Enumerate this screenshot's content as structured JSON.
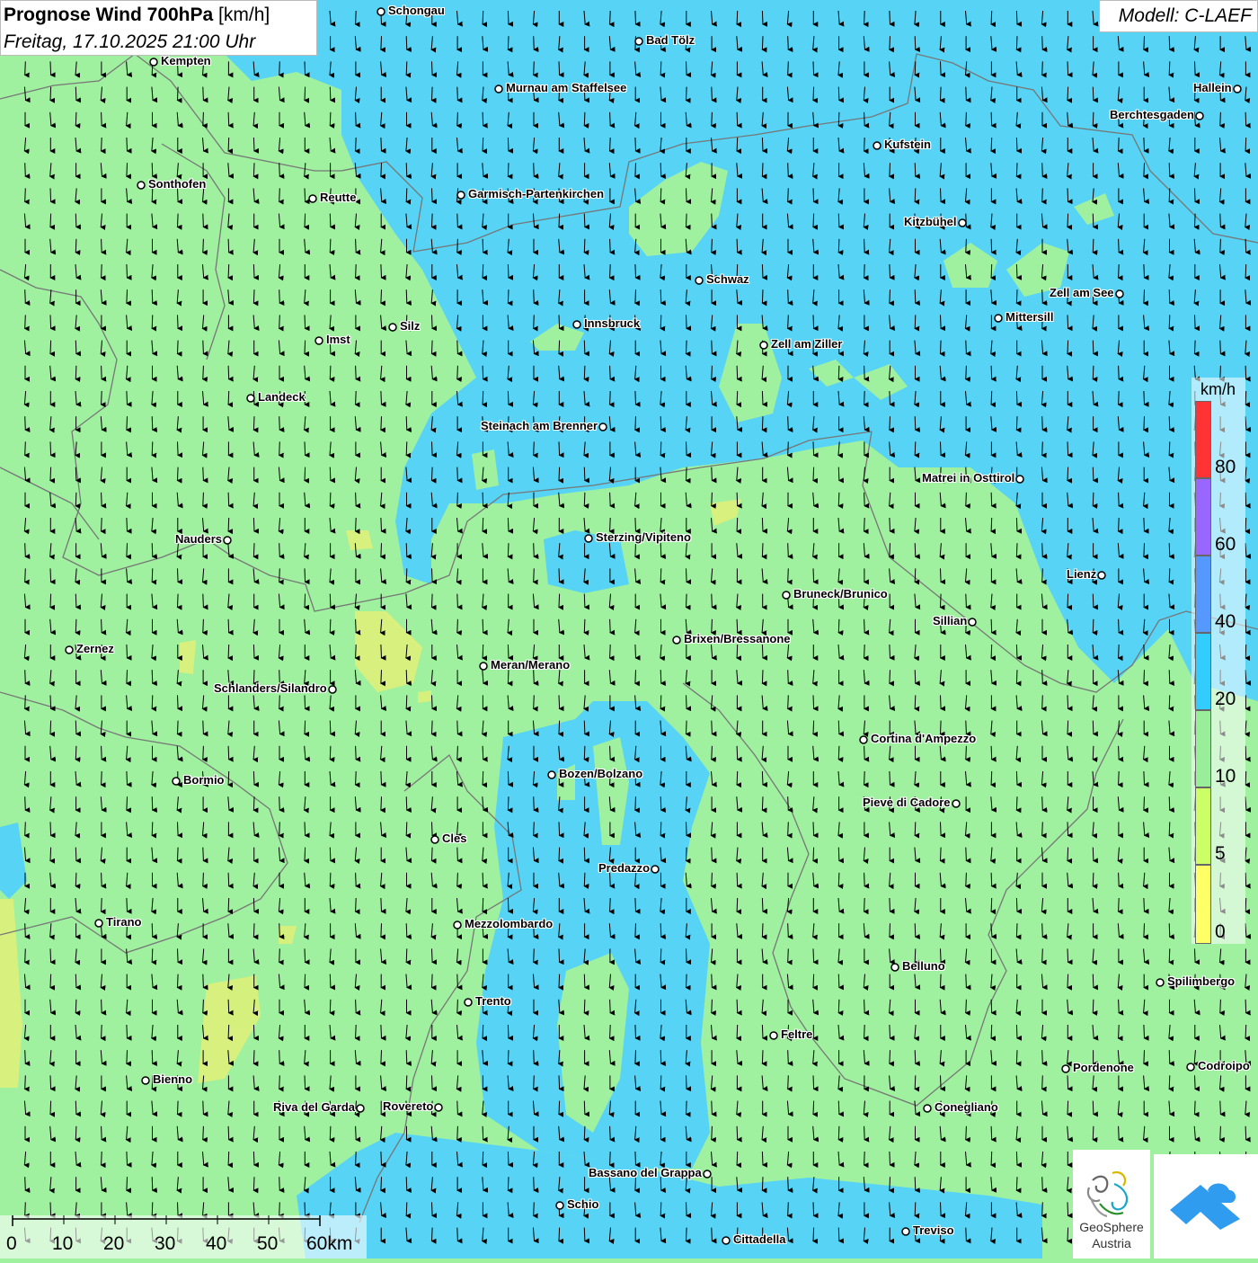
{
  "header": {
    "title_bold": "Prognose Wind 700hPa",
    "title_unit": "[km/h]",
    "datetime": "Freitag, 17.10.2025 21:00 Uhr",
    "model": "Modell: C-LAEF"
  },
  "cities": [
    {
      "name": "Schongau",
      "lx": "right"
    },
    {
      "name": "Bad Tölz",
      "lx": "right"
    },
    {
      "name": "Kempten",
      "lx": "right"
    },
    {
      "name": "Murnau am Staffelsee",
      "lx": "right"
    },
    {
      "name": "Hallein",
      "lx": "left"
    },
    {
      "name": "Berchtesgaden",
      "lx": "left"
    },
    {
      "name": "Kufstein",
      "lx": "right"
    },
    {
      "name": "Sonthofen",
      "lx": "right"
    },
    {
      "name": "Reutte",
      "lx": "right"
    },
    {
      "name": "Garmisch-Partenkirchen",
      "lx": "right"
    },
    {
      "name": "Kitzbühel",
      "lx": "left"
    },
    {
      "name": "Schwaz",
      "lx": "right"
    },
    {
      "name": "Zell am See",
      "lx": "left"
    },
    {
      "name": "Innsbruck",
      "lx": "right"
    },
    {
      "name": "Mittersill",
      "lx": "right"
    },
    {
      "name": "Silz",
      "lx": "right"
    },
    {
      "name": "Imst",
      "lx": "right"
    },
    {
      "name": "Zell am Ziller",
      "lx": "right"
    },
    {
      "name": "Landeck",
      "lx": "right"
    },
    {
      "name": "Steinach am Brenner",
      "lx": "left"
    },
    {
      "name": "Matrei in Osttirol",
      "lx": "left"
    },
    {
      "name": "Nauders",
      "lx": "left"
    },
    {
      "name": "Sterzing/Vipiteno",
      "lx": "right"
    },
    {
      "name": "Lienz",
      "lx": "left"
    },
    {
      "name": "Bruneck/Brunico",
      "lx": "right"
    },
    {
      "name": "Sillian",
      "lx": "left"
    },
    {
      "name": "Brixen/Bressanone",
      "lx": "right"
    },
    {
      "name": "Zernez",
      "lx": "right"
    },
    {
      "name": "Meran/Merano",
      "lx": "right"
    },
    {
      "name": "Schlanders/Silandro",
      "lx": "left"
    },
    {
      "name": "Cortina d'Ampezzo",
      "lx": "right"
    },
    {
      "name": "Bozen/Bolzano",
      "lx": "right"
    },
    {
      "name": "Bormio",
      "lx": "right"
    },
    {
      "name": "Pieve di Cadore",
      "lx": "left"
    },
    {
      "name": "Cles",
      "lx": "right"
    },
    {
      "name": "Predazzo",
      "lx": "left"
    },
    {
      "name": "Tirano",
      "lx": "right"
    },
    {
      "name": "Mezzolombardo",
      "lx": "right"
    },
    {
      "name": "Belluno",
      "lx": "right"
    },
    {
      "name": "Spilimbergo",
      "lx": "right"
    },
    {
      "name": "Trento",
      "lx": "right"
    },
    {
      "name": "Feltre",
      "lx": "right"
    },
    {
      "name": "Pordenone",
      "lx": "right"
    },
    {
      "name": "Codroipo",
      "lx": "right"
    },
    {
      "name": "Bienno",
      "lx": "right"
    },
    {
      "name": "Riva del Garda",
      "lx": "left"
    },
    {
      "name": "Rovereto",
      "lx": "left"
    },
    {
      "name": "Conegliano",
      "lx": "right"
    },
    {
      "name": "Bassano del Grappa",
      "lx": "left"
    },
    {
      "name": "Schio",
      "lx": "right"
    },
    {
      "name": "Treviso",
      "lx": "right"
    },
    {
      "name": "Cittadella",
      "lx": "right"
    }
  ],
  "legend": {
    "unit": "km/h",
    "labels": [
      "80",
      "60",
      "40",
      "20",
      "10",
      "5",
      "0"
    ],
    "classes": [
      {
        "from": 0,
        "to": 5,
        "color": "#ffff66"
      },
      {
        "from": 5,
        "to": 10,
        "color": "#ccff66"
      },
      {
        "from": 10,
        "to": 20,
        "color": "#99ee99"
      },
      {
        "from": 20,
        "to": 40,
        "color": "#33ccff"
      },
      {
        "from": 40,
        "to": 60,
        "color": "#5599ff"
      },
      {
        "from": 60,
        "to": 80,
        "color": "#9966ff"
      },
      {
        "from": 80,
        "to": null,
        "color": "#ff3333"
      }
    ]
  },
  "scale_bar": {
    "labels": [
      "0",
      "10",
      "20",
      "30",
      "40",
      "50",
      "60km"
    ]
  },
  "logos": {
    "geosphere_line1": "GeoSphere",
    "geosphere_line2": "Austria"
  },
  "wind_direction": "north"
}
